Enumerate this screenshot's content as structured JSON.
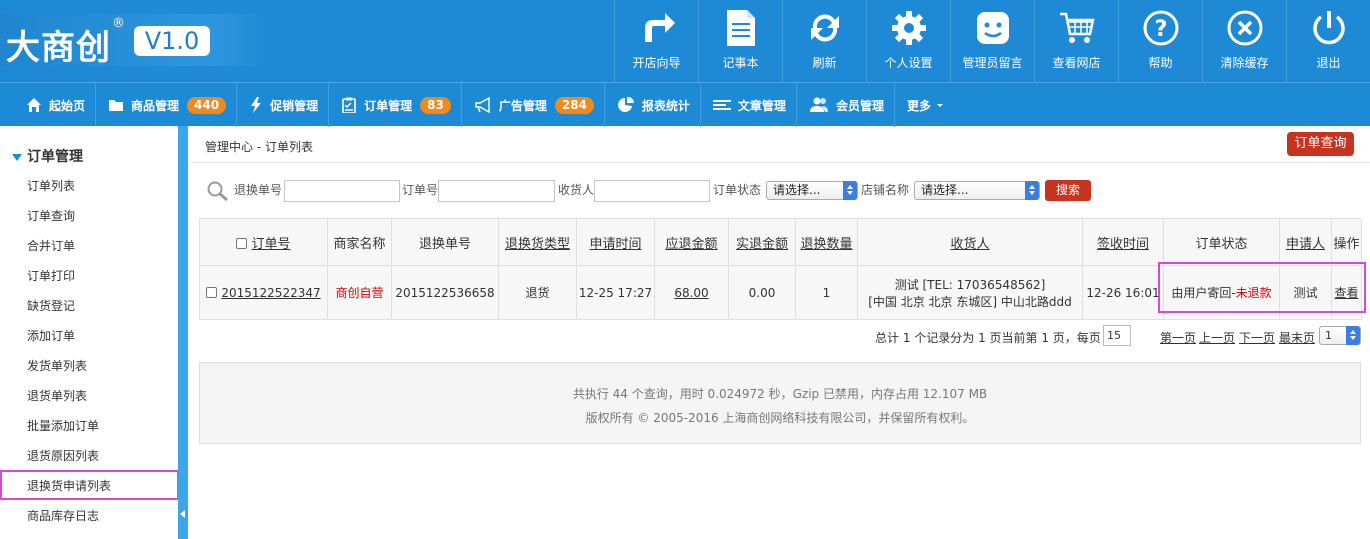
{
  "logo": {
    "text": "大商创",
    "reg": "®",
    "version": "V1.0"
  },
  "topnav": [
    {
      "label": "开店向导",
      "icon": "share-arrow-icon"
    },
    {
      "label": "记事本",
      "icon": "notepad-icon"
    },
    {
      "label": "刷新",
      "icon": "refresh-icon"
    },
    {
      "label": "个人设置",
      "icon": "gear-icon"
    },
    {
      "label": "管理员留言",
      "icon": "message-face-icon"
    },
    {
      "label": "查看网店",
      "icon": "cart-icon"
    },
    {
      "label": "帮助",
      "icon": "help-icon"
    },
    {
      "label": "清除缓存",
      "icon": "clear-icon"
    },
    {
      "label": "退出",
      "icon": "power-icon"
    }
  ],
  "menu": [
    {
      "label": "起始页",
      "icon": "home-icon"
    },
    {
      "label": "商品管理",
      "icon": "folder-icon",
      "badge": "440"
    },
    {
      "label": "促销管理",
      "icon": "lightning-icon"
    },
    {
      "label": "订单管理",
      "icon": "clipboard-icon",
      "badge": "83"
    },
    {
      "label": "广告管理",
      "icon": "megaphone-icon",
      "badge": "284"
    },
    {
      "label": "报表统计",
      "icon": "pie-chart-icon"
    },
    {
      "label": "文章管理",
      "icon": "list-icon"
    },
    {
      "label": "会员管理",
      "icon": "users-icon"
    },
    {
      "label": "更多",
      "icon": "caret-down-icon"
    }
  ],
  "sidebar": {
    "title": "订单管理",
    "items": [
      "订单列表",
      "订单查询",
      "合并订单",
      "订单打印",
      "缺货登记",
      "添加订单",
      "发货单列表",
      "退货单列表",
      "批量添加订单",
      "退货原因列表",
      "退换货申请列表",
      "商品库存日志"
    ]
  },
  "breadcrumb": "管理中心  -  订单列表",
  "query_button": "订单查询",
  "search": {
    "return_no_label": "退换单号",
    "order_no_label": "订单号",
    "consignee_label": "收货人",
    "status_label": "订单状态",
    "status_value": "请选择...",
    "shop_label": "店铺名称",
    "shop_value": "请选择...",
    "button": "搜索"
  },
  "table": {
    "headers": [
      "订单号",
      "商家名称",
      "退换单号",
      "退换货类型",
      "申请时间",
      "应退金额",
      "实退金额",
      "退换数量",
      "收货人",
      "签收时间",
      "订单状态",
      "申请人",
      "操作"
    ],
    "row": {
      "order_no": "2015122522347",
      "merchant": "商创自营",
      "return_no": "2015122536658",
      "type": "退货",
      "apply_time": "12-25 17:27",
      "refund_due": "68.00",
      "refund_actual": "0.00",
      "quantity": "1",
      "consignee_line1": "测试 [TEL: 17036548562]",
      "consignee_line2": "[中国 北京 北京 东城区] 中山北路ddd",
      "sign_time": "12-26 16:01",
      "status_prefix": "由用户寄回-",
      "status_red": "未退款",
      "applicant": "测试",
      "action": "查看"
    }
  },
  "pager": {
    "info": "总计 1 个记录分为 1 页当前第 1 页，每页",
    "per_page": "15",
    "first": "第一页",
    "prev": "上一页",
    "next": "下一页",
    "last": "最末页",
    "page": "1"
  },
  "footer": {
    "line1": "共执行 44 个查询，用时 0.024972 秒，Gzip 已禁用，内存占用 12.107 MB",
    "line2": "版权所有 © 2005-2016 上海商创网络科技有限公司，并保留所有权利。"
  }
}
